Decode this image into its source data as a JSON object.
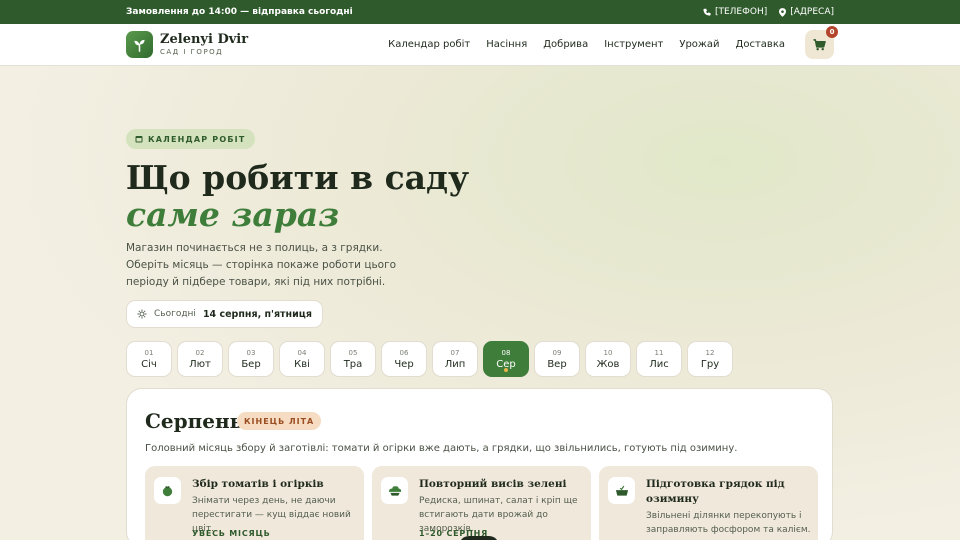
{
  "topbar": {
    "notice": "Замовлення до 14:00 — відправка сьогодні",
    "phone": "[ТЕЛЕФОН]",
    "address": "[АДРЕСА]"
  },
  "brand": {
    "name": "Zelenyi Dvir",
    "tagline": "САД І ГОРОД"
  },
  "nav": [
    "Календар робіт",
    "Насіння",
    "Добрива",
    "Інструмент",
    "Урожай",
    "Доставка"
  ],
  "cart": {
    "count": "0"
  },
  "hero": {
    "chip": "КАЛЕНДАР РОБІТ",
    "title_line1": "Що робити в саду",
    "title_line2": "саме зараз",
    "lead": "Магазин починається не з полиць, а з грядки. Оберіть місяць — сторінка покаже роботи цього періоду й підбере товари, які під них потрібні.",
    "today_label": "Сьогодні",
    "today_value": "14 серпня, п'ятниця"
  },
  "months": [
    {
      "num": "01",
      "name": "Січ"
    },
    {
      "num": "02",
      "name": "Лют"
    },
    {
      "num": "03",
      "name": "Бер"
    },
    {
      "num": "04",
      "name": "Кві"
    },
    {
      "num": "05",
      "name": "Тра"
    },
    {
      "num": "06",
      "name": "Чер"
    },
    {
      "num": "07",
      "name": "Лип"
    },
    {
      "num": "08",
      "name": "Сер"
    },
    {
      "num": "09",
      "name": "Вер"
    },
    {
      "num": "10",
      "name": "Жов"
    },
    {
      "num": "11",
      "name": "Лис"
    },
    {
      "num": "12",
      "name": "Гру"
    }
  ],
  "active_month": "08",
  "panel": {
    "title": "Серпень",
    "badge": "КІНЕЦЬ ЛІТА",
    "description": "Головний місяць збору й заготівлі: томати й огірки вже дають, а грядки, що звільнились, готують під озимину.",
    "cards": [
      {
        "title": "Збір томатів і огірків",
        "text": "Знімати через день, не даючи перестигати — кущ віддає новий цвіт.",
        "meta": "УВЕСЬ МІСЯЦЬ"
      },
      {
        "title": "Повторний висів зелені",
        "text": "Редиска, шпинат, салат і кріп ще встигають дати врожай до заморозків.",
        "meta": "1–20 СЕРПНЯ"
      },
      {
        "title": "Підготовка грядок під озимину",
        "text": "Звільнені ділянки перекопують і заправляють фосфором та калієм.",
        "meta": ""
      }
    ]
  },
  "colors": {
    "brand_green": "#2f5a2c",
    "accent_green": "#3f7d3a",
    "badge_orange": "#f6dcc2",
    "card_bg": "#f0e8db"
  }
}
